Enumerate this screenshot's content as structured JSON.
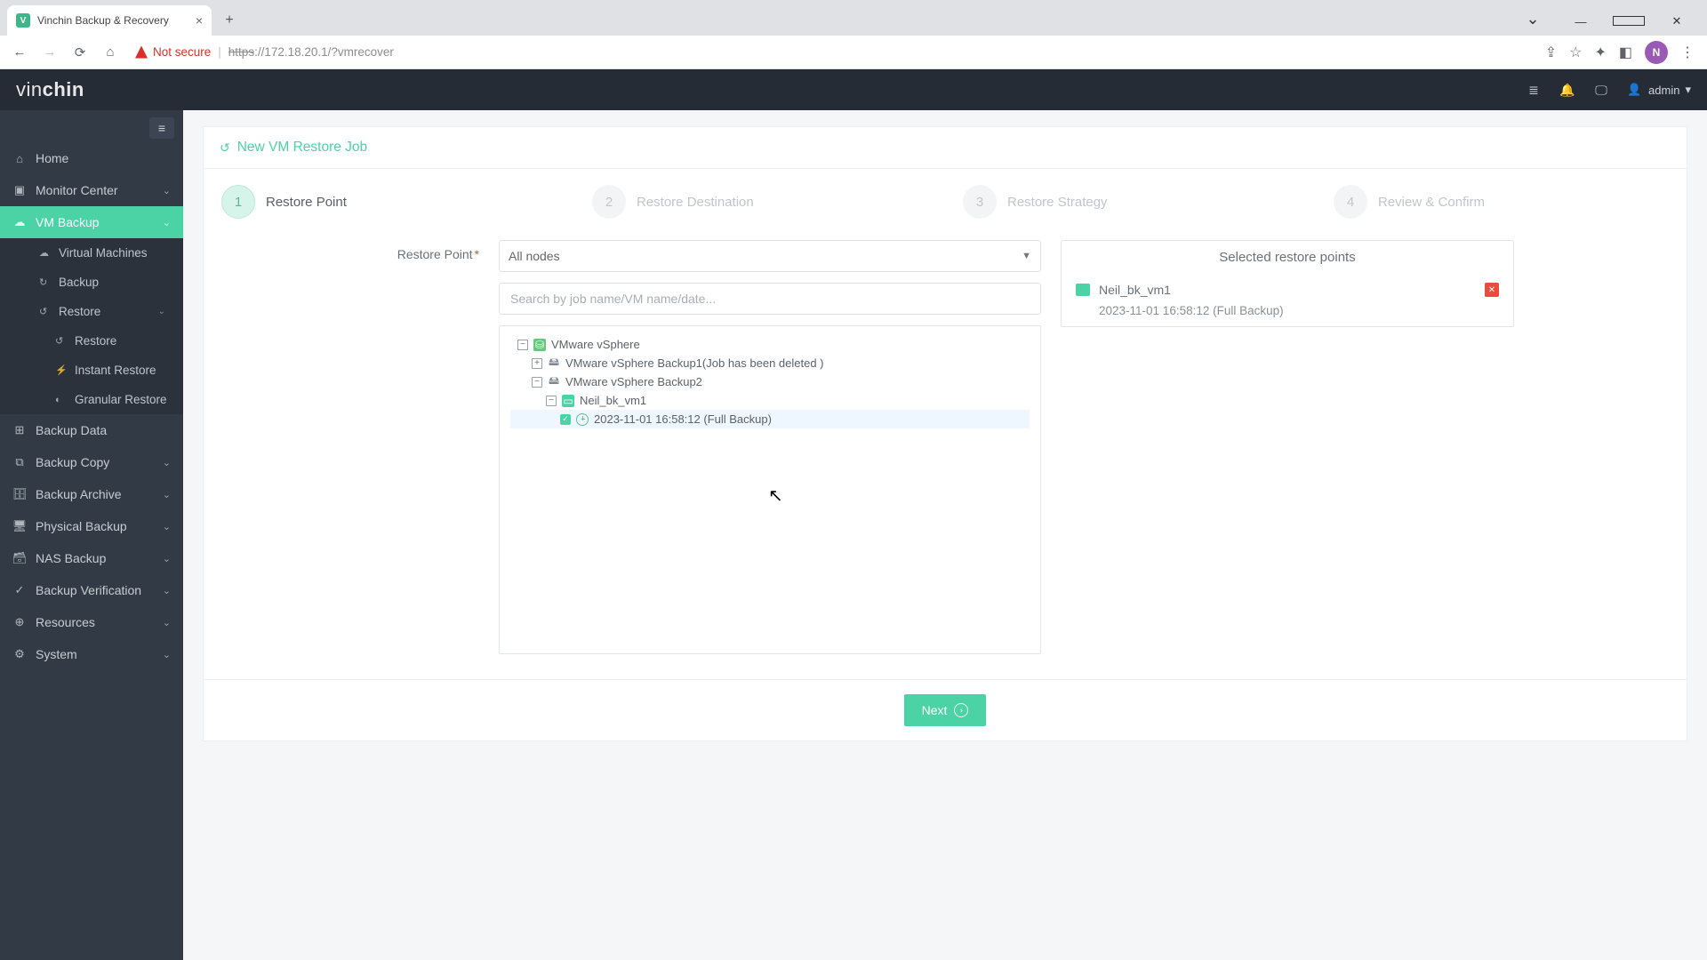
{
  "browser": {
    "tab_title": "Vinchin Backup & Recovery",
    "favicon_letter": "V",
    "url_scheme": "https",
    "url_rest": "://172.18.20.1/?vmrecover",
    "insecure_label": "Not secure",
    "avatar_letter": "N"
  },
  "header": {
    "logo_prefix": "vin",
    "logo_suffix": "chin",
    "user": "admin"
  },
  "sidebar": {
    "items": [
      {
        "icon": "⌂",
        "label": "Home",
        "active": false
      },
      {
        "icon": "▣",
        "label": "Monitor Center",
        "active": false,
        "chev": true
      },
      {
        "icon": "☁",
        "label": "VM Backup",
        "active": true,
        "chev": true
      },
      {
        "icon": "⊞",
        "label": "Backup Data",
        "active": false
      },
      {
        "icon": "⧉",
        "label": "Backup Copy",
        "active": false,
        "chev": true
      },
      {
        "icon": "🗄",
        "label": "Backup Archive",
        "active": false,
        "chev": true
      },
      {
        "icon": "🖥",
        "label": "Physical Backup",
        "active": false,
        "chev": true
      },
      {
        "icon": "🗃",
        "label": "NAS Backup",
        "active": false,
        "chev": true
      },
      {
        "icon": "✓",
        "label": "Backup Verification",
        "active": false,
        "chev": true
      },
      {
        "icon": "⊕",
        "label": "Resources",
        "active": false,
        "chev": true
      },
      {
        "icon": "⚙",
        "label": "System",
        "active": false,
        "chev": true
      }
    ],
    "sub_vmbackup": [
      {
        "icon": "☁",
        "label": "Virtual Machines",
        "level": 1
      },
      {
        "icon": "↻",
        "label": "Backup",
        "level": 1
      },
      {
        "icon": "↺",
        "label": "Restore",
        "level": 1,
        "chev": true
      },
      {
        "icon": "↺",
        "label": "Restore",
        "level": 2
      },
      {
        "icon": "⚡",
        "label": "Instant Restore",
        "level": 2
      },
      {
        "icon": "◐",
        "label": "Granular Restore",
        "level": 2
      }
    ]
  },
  "page": {
    "title": "New VM Restore Job",
    "steps": [
      {
        "num": "1",
        "label": "Restore Point",
        "state": "active"
      },
      {
        "num": "2",
        "label": "Restore Destination",
        "state": "muted"
      },
      {
        "num": "3",
        "label": "Restore Strategy",
        "state": "muted"
      },
      {
        "num": "4",
        "label": "Review & Confirm",
        "state": "muted"
      }
    ],
    "field_label": "Restore Point",
    "node_select": "All nodes",
    "search_placeholder": "Search by job name/VM name/date...",
    "tree": {
      "root": "VMware vSphere",
      "job1": "VMware vSphere Backup1(Job has been deleted )",
      "job2": "VMware vSphere Backup2",
      "vm": "Neil_bk_vm1",
      "point": "2023-11-01 16:58:12 (Full  Backup)"
    },
    "selected_panel_title": "Selected restore points",
    "selected_vm": "Neil_bk_vm1",
    "selected_point": "2023-11-01 16:58:12 (Full Backup)",
    "next_button": "Next"
  }
}
